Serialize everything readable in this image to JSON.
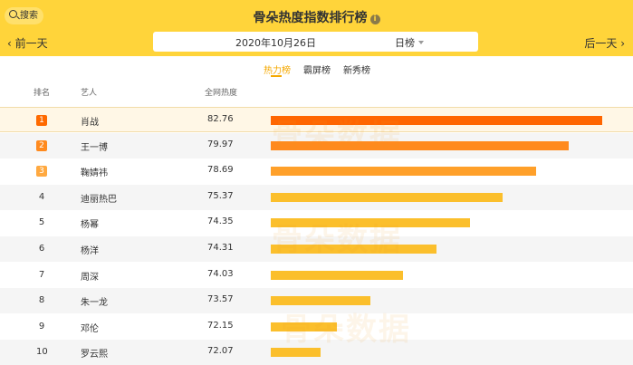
{
  "header": {
    "search_label": "搜索",
    "title": "骨朵热度指数排行榜",
    "info_icon": "info-icon",
    "prev_day": "前一天",
    "next_day": "后一天",
    "date": "2020年10月26日",
    "period": "日榜"
  },
  "tabs": [
    {
      "label": "热力榜",
      "active": true
    },
    {
      "label": "霸屏榜",
      "active": false
    },
    {
      "label": "新秀榜",
      "active": false
    }
  ],
  "columns": {
    "rank": "排名",
    "artist": "艺人",
    "score": "全网热度"
  },
  "rows": [
    {
      "rank": "1",
      "name": "肖战",
      "score": "82.76",
      "fraction": 1.0,
      "color": "#ff6600"
    },
    {
      "rank": "2",
      "name": "王一博",
      "score": "79.97",
      "fraction": 0.9,
      "color": "#ff8a1e"
    },
    {
      "rank": "3",
      "name": "鞠婧祎",
      "score": "78.69",
      "fraction": 0.8,
      "color": "#ffa02a"
    },
    {
      "rank": "4",
      "name": "迪丽热巴",
      "score": "75.37",
      "fraction": 0.7,
      "color": "#fbbf2c"
    },
    {
      "rank": "5",
      "name": "杨幂",
      "score": "74.35",
      "fraction": 0.6,
      "color": "#fbbf2c"
    },
    {
      "rank": "6",
      "name": "杨洋",
      "score": "74.31",
      "fraction": 0.5,
      "color": "#fbbf2c"
    },
    {
      "rank": "7",
      "name": "周深",
      "score": "74.03",
      "fraction": 0.4,
      "color": "#fbbf2c"
    },
    {
      "rank": "8",
      "name": "朱一龙",
      "score": "73.57",
      "fraction": 0.3,
      "color": "#fbbf2c"
    },
    {
      "rank": "9",
      "name": "邓伦",
      "score": "72.15",
      "fraction": 0.2,
      "color": "#fbbf2c"
    },
    {
      "rank": "10",
      "name": "罗云熙",
      "score": "72.07",
      "fraction": 0.15,
      "color": "#fbbf2c"
    }
  ],
  "badge_colors": [
    "#ff6a00",
    "#ff8a1e",
    "#ffa940"
  ],
  "watermark": "骨朵数据"
}
